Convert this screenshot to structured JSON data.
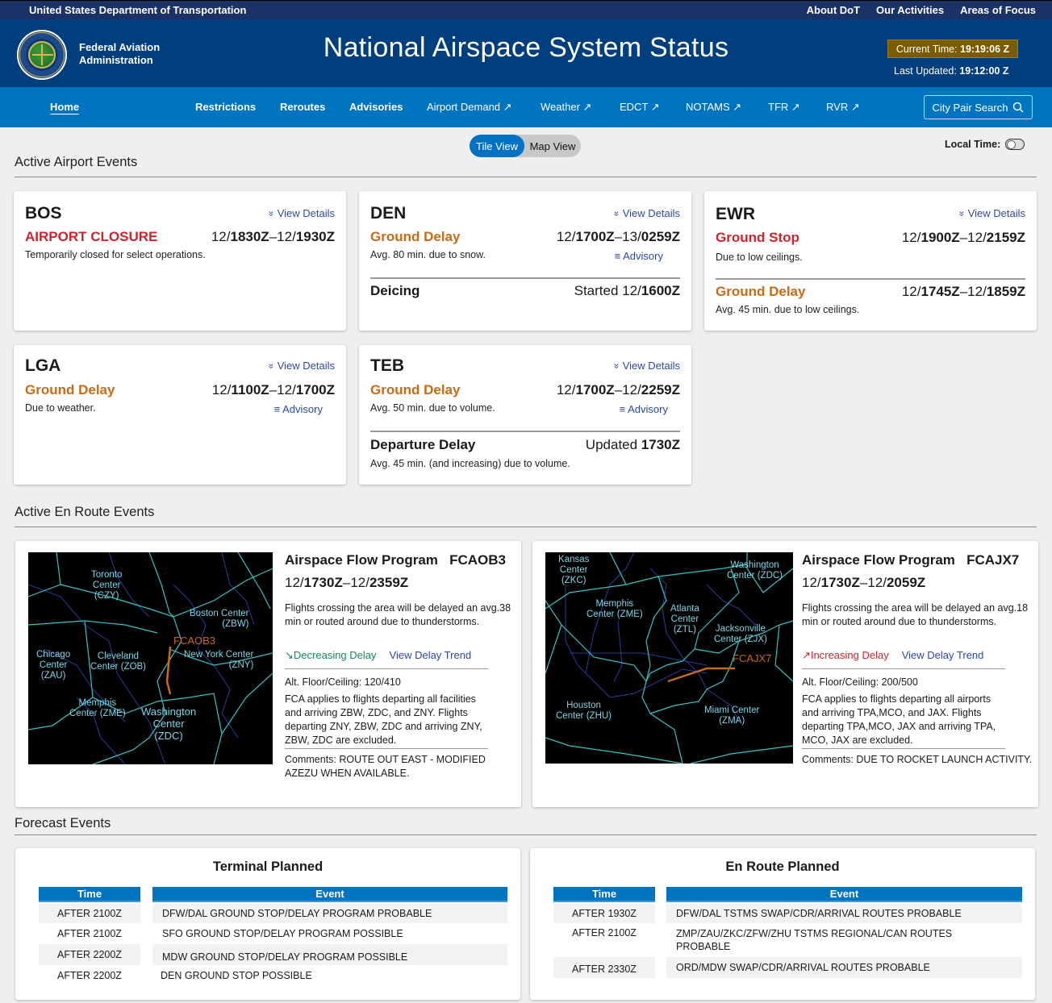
{
  "topbar": {
    "agency": "United States Department of Transportation",
    "links": [
      "About DoT",
      "Our Activities",
      "Areas of Focus"
    ]
  },
  "header": {
    "org_line1": "Federal Aviation",
    "org_line2": "Administration",
    "title": "National Airspace System Status",
    "current_time_label": "Current Time:",
    "current_time": "19:19:06 Z",
    "last_updated_label": "Last Updated:",
    "last_updated": "19:12:00 Z",
    "current_time_bg": "#7c5a00"
  },
  "nav": {
    "items": [
      "Home",
      "Restrictions",
      "Reroutes",
      "Advisories",
      "Airport Demand ↗",
      "Weather ↗",
      "EDCT ↗",
      "NOTAMS ↗",
      "TFR ↗",
      "RVR ↗"
    ],
    "city_pair": "City Pair Search"
  },
  "view_toggle": {
    "tile": "Tile View",
    "map": "Map View",
    "selected": "Tile View"
  },
  "local_time": {
    "label": "Local Time:",
    "on": false
  },
  "sections": {
    "airport": "Active Airport Events",
    "enroute": "Active En Route Events",
    "forecast": "Forecast Events"
  },
  "colors": {
    "red": "#d0242c",
    "orange": "#c76b16",
    "link": "#2d48a6",
    "nav": "#0074c1",
    "header": "#003e7e"
  },
  "airports": [
    {
      "code": "BOS",
      "view_details": "View Details",
      "events": [
        {
          "type": "AIRPORT CLOSURE",
          "color": "red",
          "t_start_day": "12/",
          "t_start": "1830Z",
          "t_end_day": "12/",
          "t_end": "1930Z",
          "desc": "Temporarily closed for select operations."
        }
      ]
    },
    {
      "code": "DEN",
      "view_details": "View Details",
      "events": [
        {
          "type": "Ground Delay",
          "color": "orange",
          "t_start_day": "12/",
          "t_start": "1700Z",
          "t_end_day": "13/",
          "t_end": "0259Z",
          "desc": "Avg. 80 min. due to snow.",
          "advisory": "Advisory"
        },
        {
          "type": "Deicing",
          "color": "dark",
          "status_prefix": "Started 12/",
          "status_value": "1600Z"
        }
      ]
    },
    {
      "code": "EWR",
      "view_details": "View Details",
      "events": [
        {
          "type": "Ground Stop",
          "color": "red",
          "t_start_day": "12/",
          "t_start": "1900Z",
          "t_end_day": "12/",
          "t_end": "2159Z",
          "desc": "Due to low ceilings."
        },
        {
          "type": "Ground Delay",
          "color": "orange",
          "t_start_day": "12/",
          "t_start": "1745Z",
          "t_end_day": "12/",
          "t_end": "1859Z",
          "desc": "Avg. 45 min. due to low ceilings."
        }
      ]
    },
    {
      "code": "LGA",
      "view_details": "View Details",
      "events": [
        {
          "type": "Ground Delay",
          "color": "orange",
          "t_start_day": "12/",
          "t_start": "1100Z",
          "t_end_day": "12/",
          "t_end": "1700Z",
          "desc": "Due to weather.",
          "advisory": "Advisory"
        }
      ]
    },
    {
      "code": "TEB",
      "view_details": "View Details",
      "events": [
        {
          "type": "Ground Delay",
          "color": "orange",
          "t_start_day": "12/",
          "t_start": "1700Z",
          "t_end_day": "12/",
          "t_end": "2259Z",
          "desc": "Avg. 50 min. due to volume.",
          "advisory": "Advisory"
        },
        {
          "type": "Departure Delay",
          "color": "dark",
          "status_prefix": "Updated ",
          "status_value": "1730Z",
          "desc": "Avg. 45 min. (and increasing) due to volume."
        }
      ]
    }
  ],
  "enroute": [
    {
      "program": "Airspace Flow Program",
      "id": "FCAOB3",
      "t_start_day": "12/",
      "t_start": "1730Z",
      "t_end_day": "12/",
      "t_end": "2359Z",
      "summary": "Flights crossing the area will be delayed an avg.38 min or routed around due to thunderstorms.",
      "trend": "Decreasing Delay",
      "trend_dir": "decreasing",
      "trend_link": "View Delay Trend",
      "alt": "Alt. Floor/Ceiling: 120/410",
      "fca": "FCA applies to flights departing all facilities and arriving ZBW, ZDC, and ZNY. Flights departing ZNY, ZBW, ZDC and arriving ZNY, ZBW, ZDC are excluded.",
      "comments": "Comments: ROUTE OUT EAST - MODIFIED AZEZU WHEN AVAILABLE.",
      "map_labels": [
        "Toronto\nCenter\n(CZY)",
        "Boston Center\n(ZBW)",
        "Chicago\nCenter\n(ZAU)",
        "Cleveland\nCenter (ZOB)",
        "New York Center\n(ZNY)",
        "Memphis\nCenter (ZME)",
        "Washington\nCenter\n(ZDC)"
      ],
      "map_fca_label": "FCAOB3"
    },
    {
      "program": "Airspace Flow Program",
      "id": "FCAJX7",
      "t_start_day": "12/",
      "t_start": "1730Z",
      "t_end_day": "12/",
      "t_end": "2059Z",
      "summary": "Flights crossing the area will be delayed an avg.18 min or routed around due to thunderstorms.",
      "trend": "Increasing Delay",
      "trend_dir": "increasing",
      "trend_link": "View Delay Trend",
      "alt": "Alt. Floor/Ceiling: 200/500",
      "fca": "FCA applies to flights departing all airports and arriving TPA,MCO, and JAX. Flights departing TPA,MCO, JAX and arriving TPA, MCO, JAX are  excluded.",
      "comments": "Comments: DUE TO ROCKET LAUNCH ACTIVITY.",
      "map_labels": [
        "Kansas\nCenter\n(ZKC)",
        "Washington\nCenter (ZDC)",
        "Memphis\nCenter (ZME)",
        "Atlanta\nCenter\n(ZTL)",
        "Jacksonville\nCenter (ZJX)",
        "Houston\nCenter (ZHU)",
        "Miami Center\n(ZMA)"
      ],
      "map_fca_label": "FCAJX7"
    }
  ],
  "forecast": {
    "terminal": {
      "title": "Terminal Planned",
      "headers": [
        "Time",
        "Event"
      ],
      "rows": [
        [
          "AFTER 2100Z",
          "DFW/DAL GROUND STOP/DELAY PROGRAM PROBABLE"
        ],
        [
          "AFTER 2100Z",
          "SFO GROUND STOP/DELAY PROGRAM POSSIBLE"
        ],
        [
          "AFTER 2200Z",
          "MDW GROUND STOP/DELAY PROGRAM POSSIBLE"
        ],
        [
          "AFTER 2200Z",
          "DEN GROUND STOP POSSIBLE"
        ]
      ]
    },
    "enroute": {
      "title": "En Route Planned",
      "headers": [
        "Time",
        "Event"
      ],
      "rows": [
        [
          "AFTER 1930Z",
          "DFW/DAL TSTMS SWAP/CDR/ARRIVAL ROUTES PROBABLE"
        ],
        [
          "AFTER 2100Z",
          "ZMP/ZAU/ZKC/ZFW/ZHU TSTMS REGIONAL/CAN ROUTES PROBABLE"
        ],
        [
          "AFTER 2330Z",
          "ORD/MDW SWAP/CDR/ARRIVAL ROUTES PROBABLE"
        ]
      ]
    }
  }
}
